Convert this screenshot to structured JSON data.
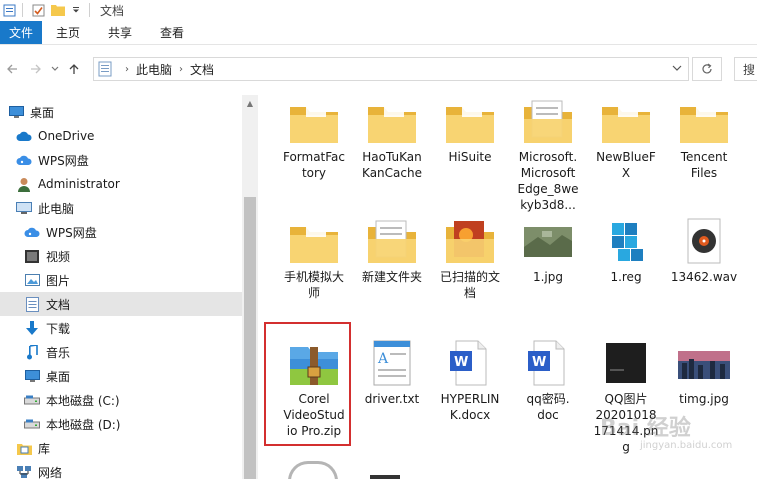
{
  "window": {
    "title": "文档"
  },
  "ribbon": {
    "tabs": [
      "文件",
      "主页",
      "共享",
      "查看"
    ]
  },
  "address": {
    "segments": [
      "此电脑",
      "文档"
    ],
    "search_placeholder": "搜"
  },
  "sidebar": {
    "items": [
      {
        "label": "桌面",
        "icon": "desktop-icon"
      },
      {
        "label": "OneDrive",
        "icon": "cloud-icon"
      },
      {
        "label": "WPS网盘",
        "icon": "wps-cloud-icon"
      },
      {
        "label": "Administrator",
        "icon": "user-icon"
      },
      {
        "label": "此电脑",
        "icon": "computer-icon"
      },
      {
        "label": "WPS网盘",
        "icon": "wps-cloud-icon"
      },
      {
        "label": "视频",
        "icon": "video-icon"
      },
      {
        "label": "图片",
        "icon": "pictures-icon"
      },
      {
        "label": "文档",
        "icon": "documents-icon",
        "selected": true
      },
      {
        "label": "下载",
        "icon": "download-icon"
      },
      {
        "label": "音乐",
        "icon": "music-icon"
      },
      {
        "label": "桌面",
        "icon": "desktop-icon"
      },
      {
        "label": "本地磁盘 (C:)",
        "icon": "drive-icon"
      },
      {
        "label": "本地磁盘 (D:)",
        "icon": "drive-icon"
      },
      {
        "label": "库",
        "icon": "library-icon"
      },
      {
        "label": "网络",
        "icon": "network-icon"
      }
    ]
  },
  "files": [
    {
      "name": "FormatFactory",
      "lines": [
        "FormatFac",
        "tory"
      ],
      "type": "folder"
    },
    {
      "name": "HaoTuKanCache",
      "lines": [
        "HaoTuKan",
        "KanCache"
      ],
      "type": "folder"
    },
    {
      "name": "HiSuite",
      "lines": [
        "HiSuite"
      ],
      "type": "folder"
    },
    {
      "name": "Microsoft.MicrosoftEdge_8wekyb3d8...",
      "lines": [
        "Microsoft.",
        "Microsoft",
        "Edge_8we",
        "kyb3d8..."
      ],
      "type": "folder-doc"
    },
    {
      "name": "NewBlueFX",
      "lines": [
        "NewBlueF",
        "X"
      ],
      "type": "folder"
    },
    {
      "name": "Tencent Files",
      "lines": [
        "Tencent",
        "Files"
      ],
      "type": "folder"
    },
    {
      "name": "手机模拟大师",
      "lines": [
        "手机模拟大",
        "师"
      ],
      "type": "folder"
    },
    {
      "name": "新建文件夹",
      "lines": [
        "新建文件夹"
      ],
      "type": "folder-doc"
    },
    {
      "name": "已扫描的文档",
      "lines": [
        "已扫描的文",
        "档"
      ],
      "type": "folder-image"
    },
    {
      "name": "1.jpg",
      "lines": [
        "1.jpg"
      ],
      "type": "jpg-map"
    },
    {
      "name": "1.reg",
      "lines": [
        "1.reg"
      ],
      "type": "reg"
    },
    {
      "name": "13462.wav",
      "lines": [
        "13462.wav"
      ],
      "type": "wav"
    },
    {
      "name": "Corel VideoStudio Pro.zip",
      "lines": [
        "Corel",
        "VideoStud",
        "io Pro.zip"
      ],
      "type": "zip"
    },
    {
      "name": "driver.txt",
      "lines": [
        "driver.txt"
      ],
      "type": "txt"
    },
    {
      "name": "HYPERLINK.docx",
      "lines": [
        "HYPERLIN",
        "K.docx"
      ],
      "type": "docx"
    },
    {
      "name": "qq密码.doc",
      "lines": [
        "qq密码.",
        "doc"
      ],
      "type": "docx"
    },
    {
      "name": "QQ图片20201018171414.png",
      "lines": [
        "QQ图片",
        "20201018",
        "171414.pn",
        "g"
      ],
      "type": "png-dark"
    },
    {
      "name": "timg.jpg",
      "lines": [
        "timg.jpg"
      ],
      "type": "jpg-city"
    }
  ],
  "watermark": {
    "text": "Bai 经验",
    "sub": "jingyan.baidu.com"
  },
  "colors": {
    "accent": "#1979ca",
    "folder": "#f5c84c",
    "highlight": "#d32f2f"
  }
}
